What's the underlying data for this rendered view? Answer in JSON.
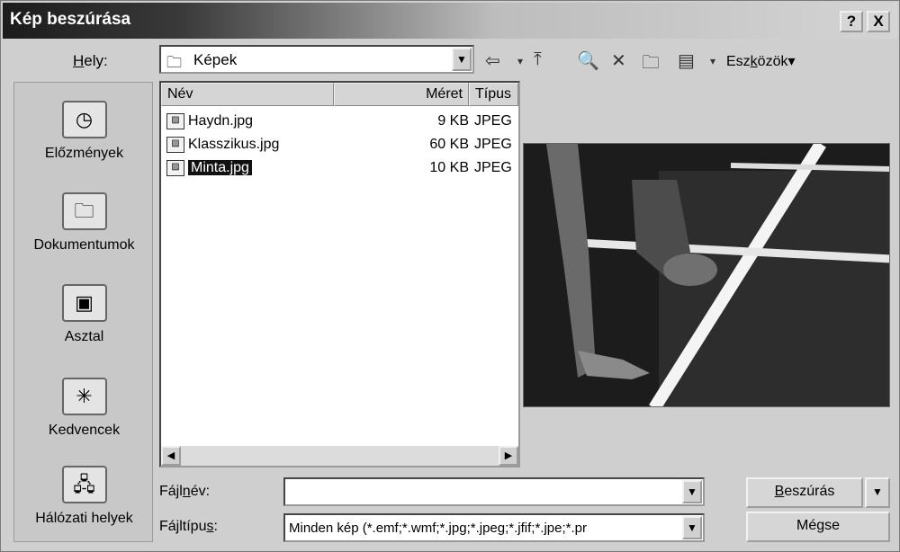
{
  "window": {
    "title": "Kép beszúrása",
    "help_label": "?",
    "close_label": "X"
  },
  "location": {
    "label_prefix": "",
    "label_mnemonic": "H",
    "label_rest": "ely:",
    "value": "Képek"
  },
  "toolbar": {
    "tools_mnemonic_pre": "Esz",
    "tools_mnemonic": "k",
    "tools_mnemonic_post": "özök",
    "tools_arrow": "▾"
  },
  "places": [
    {
      "label": "Előzmények",
      "icon": "history-icon"
    },
    {
      "label": "Dokumentumok",
      "icon": "documents-icon"
    },
    {
      "label": "Asztal",
      "icon": "desktop-icon"
    },
    {
      "label": "Kedvencek",
      "icon": "favorites-icon"
    },
    {
      "label": "Hálózati helyek",
      "icon": "network-places-icon"
    }
  ],
  "file_list": {
    "columns": [
      "Név",
      "Méret",
      "Típus"
    ],
    "files": [
      {
        "name": "Haydn.jpg",
        "size": "9 KB",
        "type": "JPEG"
      },
      {
        "name": "Klasszikus.jpg",
        "size": "60 KB",
        "type": "JPEG"
      },
      {
        "name": "Minta.jpg",
        "size": "10 KB",
        "type": "JPEG"
      }
    ],
    "selected": "Minta.jpg"
  },
  "filename": {
    "label_pre": "Fájl",
    "label_mnemonic": "n",
    "label_post": "év:",
    "value": ""
  },
  "filetype": {
    "label_pre": "Fájltípu",
    "label_mnemonic": "s",
    "label_post": ":",
    "value": "Minden kép (*.emf;*.wmf;*.jpg;*.jpeg;*.jfif;*.jpe;*.pr"
  },
  "buttons": {
    "insert_mnemonic": "B",
    "insert_rest": "eszúrás",
    "cancel": "Mégse"
  }
}
